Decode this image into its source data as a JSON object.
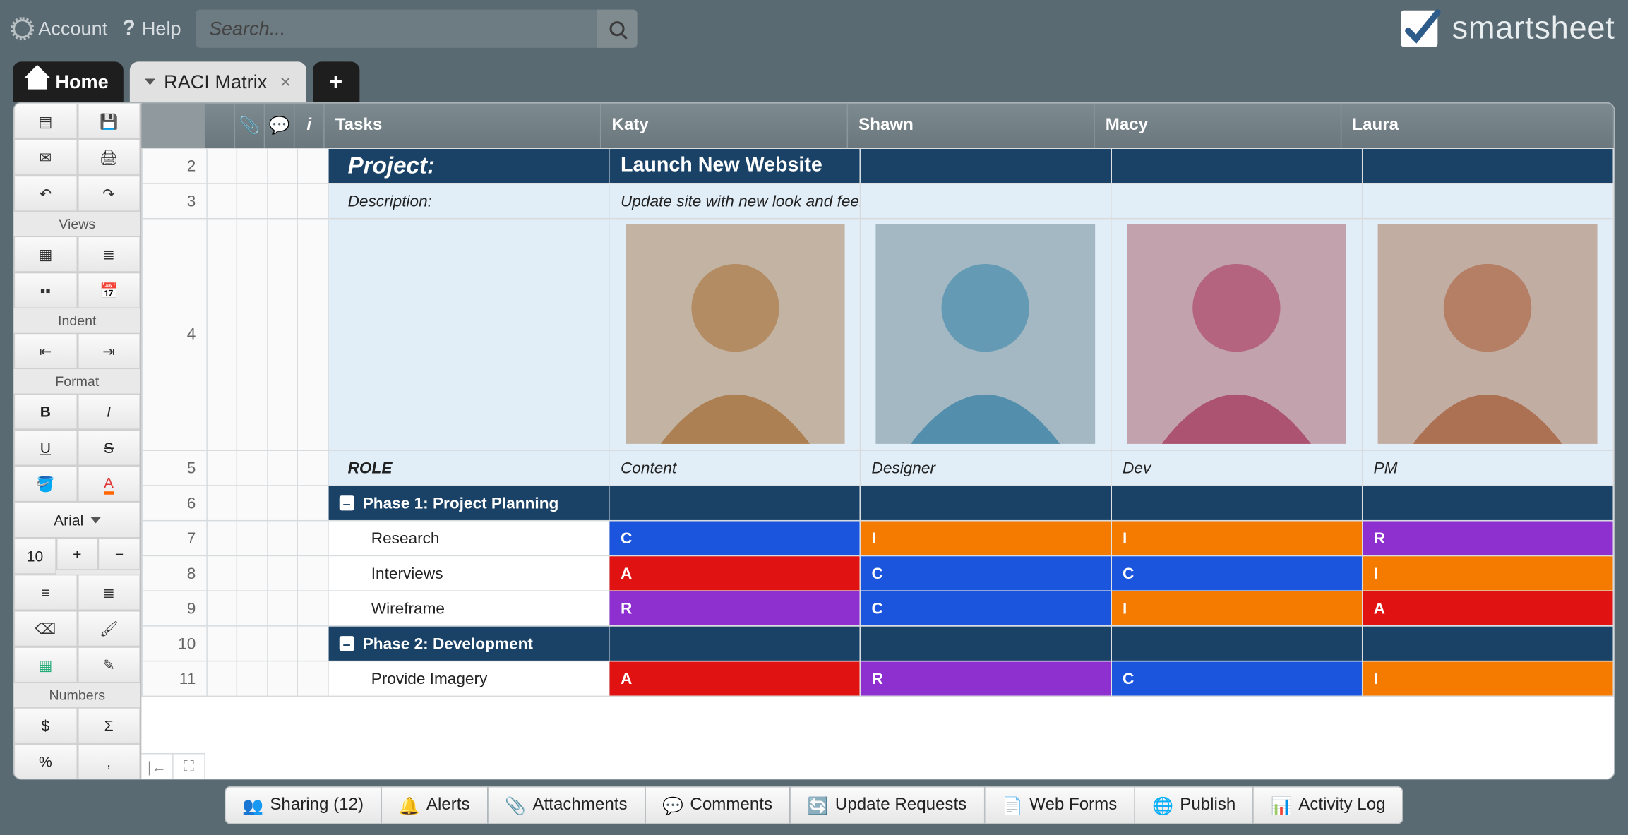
{
  "topbar": {
    "account": "Account",
    "help": "Help",
    "search_placeholder": "Search..."
  },
  "brand": "smartsheet",
  "tabs": {
    "home": "Home",
    "sheet": "RACI Matrix"
  },
  "left_toolbar": {
    "views_hdr": "Views",
    "indent_hdr": "Indent",
    "format_hdr": "Format",
    "font": "Arial",
    "font_size": "10",
    "numbers_hdr": "Numbers",
    "bold": "B",
    "italic": "I",
    "underline": "U",
    "strike": "S",
    "currency": "$",
    "sum": "Σ",
    "percent": "%",
    "comma": ","
  },
  "columns": {
    "tasks": "Tasks",
    "people": [
      "Katy",
      "Shawn",
      "Macy",
      "Laura"
    ]
  },
  "project": {
    "label": "Project:",
    "name": "Launch New Website",
    "desc_label": "Description:",
    "desc": "Update site with new look and feel"
  },
  "role_label": "ROLE",
  "roles": [
    "Content",
    "Designer",
    "Dev",
    "PM"
  ],
  "phases": [
    {
      "title": "Phase 1: Project Planning",
      "tasks": [
        {
          "name": "Research",
          "raci": [
            "C",
            "I",
            "I",
            "R"
          ]
        },
        {
          "name": "Interviews",
          "raci": [
            "A",
            "C",
            "C",
            "I"
          ]
        },
        {
          "name": "Wireframe",
          "raci": [
            "R",
            "C",
            "I",
            "A"
          ]
        }
      ]
    },
    {
      "title": "Phase 2: Development",
      "tasks": [
        {
          "name": "Provide Imagery",
          "raci": [
            "A",
            "R",
            "C",
            "I"
          ]
        }
      ]
    }
  ],
  "row_numbers": [
    "2",
    "3",
    "4",
    "5",
    "6",
    "7",
    "8",
    "9",
    "10",
    "11"
  ],
  "bottombar": {
    "sharing": "Sharing  (12)",
    "alerts": "Alerts",
    "attachments": "Attachments",
    "comments": "Comments",
    "update": "Update Requests",
    "webforms": "Web Forms",
    "publish": "Publish",
    "activity": "Activity Log"
  }
}
